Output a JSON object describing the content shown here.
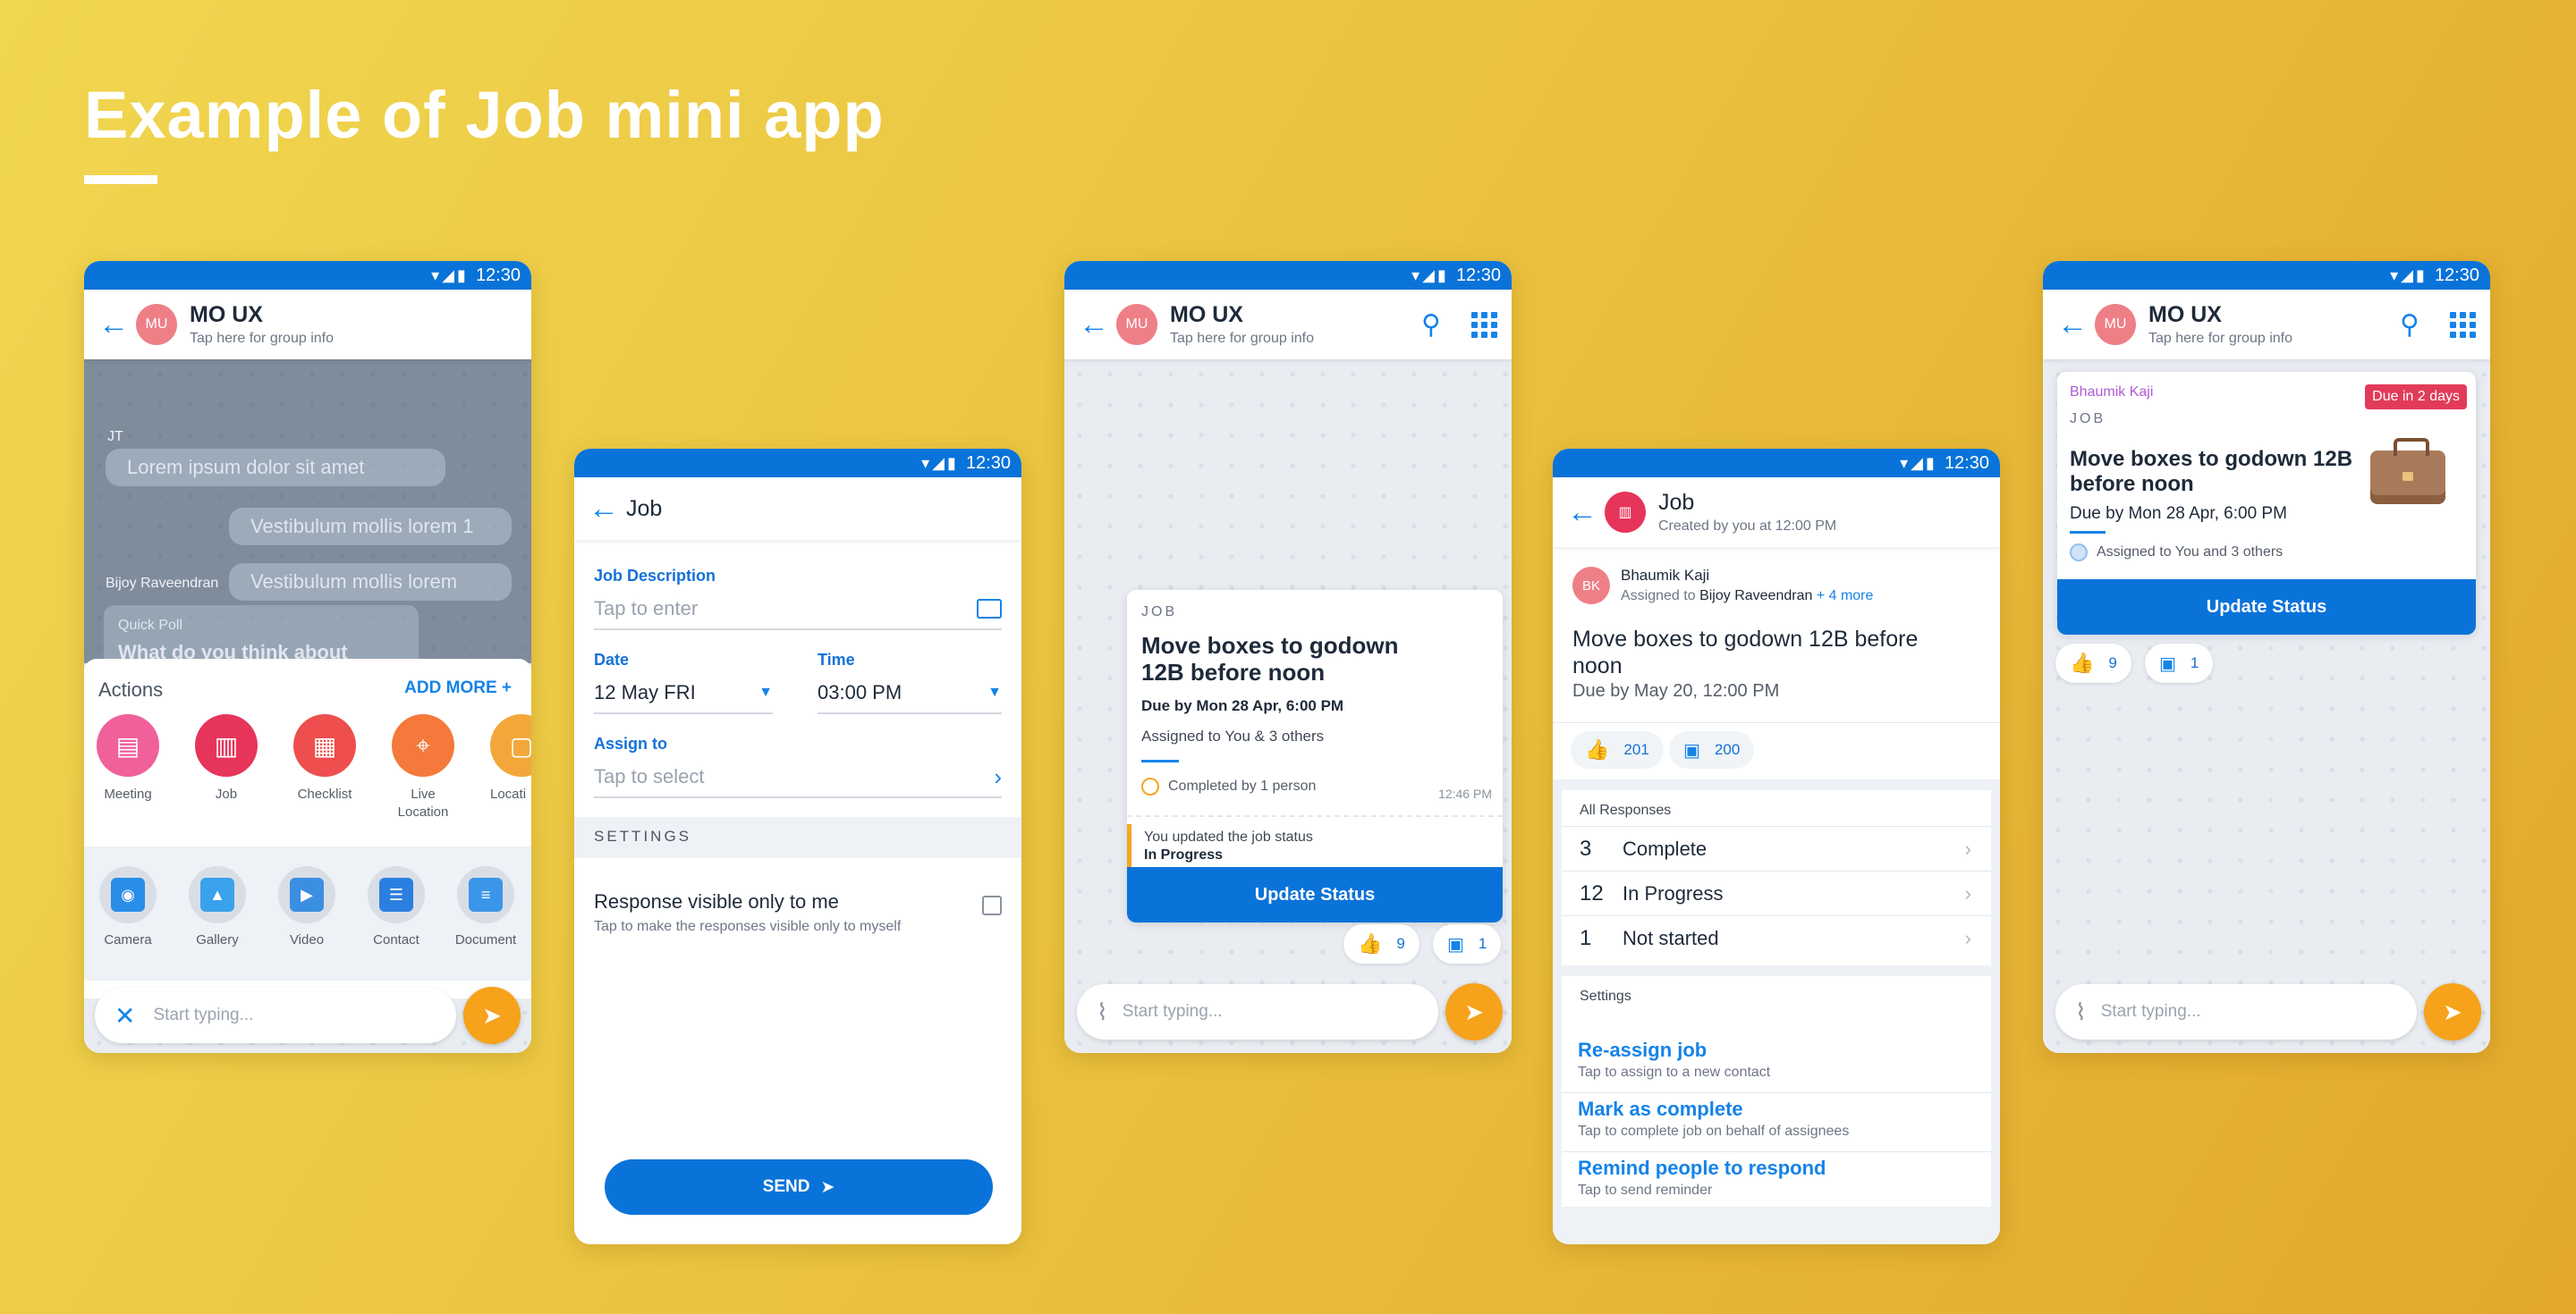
{
  "headline": "Example of Job mini app",
  "status_time": "12:30",
  "chat_header": {
    "title": "MO UX",
    "subtitle": "Tap here for group info",
    "avatar": "MU"
  },
  "phone1": {
    "messages": [
      {
        "sender": "JT",
        "text": "Lorem ipsum dolor sit amet"
      },
      {
        "text": "Vestibulum mollis lorem 1"
      },
      {
        "sender": "Bijoy Raveendran",
        "text": "Vestibulum mollis lorem"
      }
    ],
    "poll_label": "Quick Poll",
    "poll_question": "What do you think about",
    "actions_title": "Actions",
    "add_more": "ADD MORE +",
    "actions": [
      {
        "label": "Meeting",
        "color": "#f0609a"
      },
      {
        "label": "Job",
        "color": "#e7345a"
      },
      {
        "label": "Checklist",
        "color": "#ee4e4e"
      },
      {
        "label": "Live Location",
        "color": "#f4793a"
      },
      {
        "label": "Locati",
        "color": "#f3a73b"
      }
    ],
    "attachments": [
      {
        "label": "Camera",
        "color": "#2a8de8"
      },
      {
        "label": "Gallery",
        "color": "#3aa2ec"
      },
      {
        "label": "Video",
        "color": "#3a8fe0"
      },
      {
        "label": "Contact",
        "color": "#2b7fe0"
      },
      {
        "label": "Document",
        "color": "#3b95e8"
      }
    ],
    "composer_placeholder": "Start typing..."
  },
  "phone2": {
    "title": "Job",
    "job_description_label": "Job Description",
    "job_description_placeholder": "Tap to enter",
    "date_label": "Date",
    "date_value": "12 May FRI",
    "time_label": "Time",
    "time_value": "03:00 PM",
    "assign_label": "Assign to",
    "assign_placeholder": "Tap to select",
    "settings_header": "SETTINGS",
    "response_title": "Response visible only to me",
    "response_sub": "Tap to make the responses visible only to myself",
    "send_label": "SEND"
  },
  "phone3": {
    "tag": "JOB",
    "title": "Move boxes to godown 12B before noon",
    "due": "Due by Mon 28 Apr, 6:00 PM",
    "assigned": "Assigned to You & 3 others",
    "completed": "Completed by 1 person",
    "time": "12:46 PM",
    "update_line1": "You updated the job status",
    "update_line2": "In Progress",
    "update_button": "Update Status",
    "likes": "9",
    "comments": "1",
    "composer_placeholder": "Start typing..."
  },
  "phone4": {
    "title": "Job",
    "subtitle": "Created by you at 12:00 PM",
    "creator_initials": "BK",
    "creator_name": "Bhaumik Kaji",
    "assigned_prefix": "Assigned to",
    "assigned_name": "Bijoy Raveendran",
    "assigned_more": "+ 4 more",
    "job_title": "Move boxes to godown 12B before noon",
    "due": "Due by May 20, 12:00 PM",
    "likes": "201",
    "comments": "200",
    "responses_header": "All Responses",
    "responses": [
      {
        "count": "3",
        "label": "Complete"
      },
      {
        "count": "12",
        "label": "In Progress"
      },
      {
        "count": "1",
        "label": "Not started"
      }
    ],
    "settings_header": "Settings",
    "actions": [
      {
        "title": "Re-assign job",
        "sub": "Tap to assign to a new contact"
      },
      {
        "title": "Mark as complete",
        "sub": "Tap to complete job on behalf of assignees"
      },
      {
        "title": "Remind people to respond",
        "sub": "Tap to send reminder"
      }
    ]
  },
  "phone5": {
    "sender": "Bhaumik Kaji",
    "due_badge": "Due in 2 days",
    "tag": "JOB",
    "title": "Move boxes to godown 12B before noon",
    "due": "Due by Mon 28 Apr, 6:00 PM",
    "assigned": "Assigned to You and 3 others",
    "update_button": "Update Status",
    "likes": "9",
    "comments": "1",
    "composer_placeholder": "Start typing..."
  }
}
